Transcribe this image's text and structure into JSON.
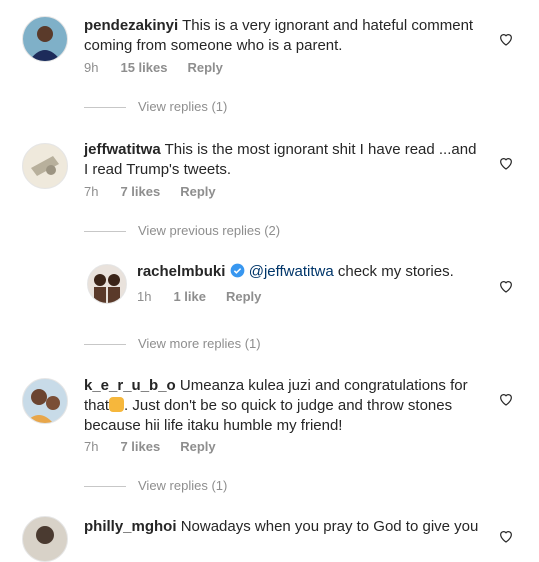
{
  "comments": [
    {
      "username": "pendezakinyi",
      "text": "This is a very ignorant and hateful comment",
      "text_line2": "coming from someone who is a parent.",
      "time": "9h",
      "likes": "15 likes",
      "reply": "Reply"
    },
    {
      "username": "jeffwatitwa",
      "text": "This is the most ignorant shit I have read ...and",
      "text_line2": "I read Trump's tweets.",
      "time": "7h",
      "likes": "7 likes",
      "reply": "Reply"
    },
    {
      "username": "rachelmbuki",
      "mention": "@jeffwatitwa",
      "text": "check my stories.",
      "time": "1h",
      "likes": "1 like",
      "reply": "Reply"
    },
    {
      "username": "k_e_r_u_b_o",
      "text": "Umeanza kulea juzi and congratulations for",
      "text_line2_a": "that",
      "text_line2_b": ". Just don't be so quick to judge and throw stones",
      "text_line3": "because hii life itaku humble my friend!",
      "time": "7h",
      "likes": "7 likes",
      "reply": "Reply"
    },
    {
      "username": "philly_mghoi",
      "text": "Nowadays when you pray to God to give you"
    }
  ],
  "view_replies_1": "View replies (1)",
  "view_previous_replies": "View previous replies (2)",
  "view_more_replies": "View more replies (1)",
  "view_replies_2": "View replies (1)",
  "colors": {
    "text": "#262626",
    "meta": "#8e8e8e",
    "verified": "#3897f0"
  },
  "icons": {
    "like": "heart-outline-icon",
    "verified": "verified-badge-icon"
  }
}
